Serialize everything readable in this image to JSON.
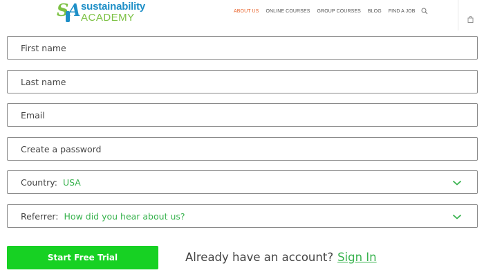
{
  "brand": {
    "logo_mark_s": "S",
    "logo_mark_a": "A",
    "name_line1": "sustainability",
    "name_line2": "ACADEMY",
    "colors": {
      "blue": "#1e8fc7",
      "green": "#7cc143"
    }
  },
  "nav": {
    "items": [
      {
        "label": "ABOUT US",
        "active": true
      },
      {
        "label": "ONLINE COURSES",
        "active": false
      },
      {
        "label": "GROUP COURSES",
        "active": false
      },
      {
        "label": "BLOG",
        "active": false
      },
      {
        "label": "FIND A JOB",
        "active": false
      }
    ],
    "active_color": "#e8632b",
    "search_icon": "search-icon",
    "cart_icon": "shopping-bag-icon"
  },
  "form": {
    "first_name_placeholder": "First name",
    "last_name_placeholder": "Last name",
    "email_placeholder": "Email",
    "password_placeholder": "Create a password",
    "country": {
      "label": "Country:",
      "value": "USA",
      "icon": "chevron-down-icon"
    },
    "referrer": {
      "label": "Referrer:",
      "value": "How did you hear about us?",
      "icon": "chevron-down-icon"
    },
    "value_color": "#37b24d"
  },
  "actions": {
    "start_trial_label": "Start Free Trial",
    "start_trial_color": "#17d123",
    "account_prompt": "Already have an account?",
    "sign_in_label": "Sign In"
  }
}
